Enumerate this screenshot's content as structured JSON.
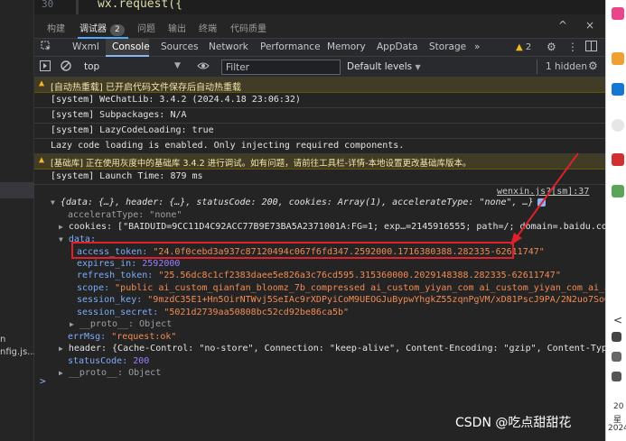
{
  "editor": {
    "line_number": "30",
    "code": "wx.request({",
    "left_fragments": [
      "n",
      "nfig.js..."
    ]
  },
  "panel_tabs": {
    "items": [
      "构建",
      "调试器",
      "问题",
      "输出",
      "终端",
      "代码质量"
    ],
    "debugger_badge": "2",
    "controls": [
      "^",
      "×"
    ]
  },
  "devtools_tabs": {
    "items": [
      "Wxml",
      "Console",
      "Sources",
      "Network",
      "Performance",
      "Memory",
      "AppData",
      "Storage"
    ],
    "more": "»",
    "warning_count": "2"
  },
  "console_toolbar": {
    "context": "top",
    "filter_placeholder": "Filter",
    "levels": "Default levels",
    "hidden": "1 hidden"
  },
  "messages": [
    {
      "type": "warn",
      "text": "[自动热重载] 已开启代码文件保存后自动热重载"
    },
    {
      "type": "log",
      "text": "[system] WeChatLib: 3.4.2 (2024.4.18 23:06:32)"
    },
    {
      "type": "log",
      "text": "[system] Subpackages: N/A"
    },
    {
      "type": "log",
      "text": "[system] LazyCodeLoading: true"
    },
    {
      "type": "log",
      "text": "Lazy code loading is enabled. Only injecting required components."
    },
    {
      "type": "warn",
      "text": "[基础库] 正在使用灰度中的基础库 3.4.2 进行调试。如有问题，请前往工具栏-详情-本地设置更改基础库版本。"
    },
    {
      "type": "log",
      "text": "[system] Launch Time: 879 ms"
    }
  ],
  "log_source": "wenxin.js?[sm]:37",
  "object": {
    "summary": "{data: {…}, header: {…}, statusCode: 200, cookies: Array(1), accelerateType: \"none\", …}",
    "acceleratetype_line": "acceleratType: \"none\"",
    "cookies_line": "cookies: [\"BAIDUID=9CC11D4C92ACC77B9E73BA5A2371001A:FG=1; exp…=2145916555; path=/; domain=.baidu.com; ver…",
    "data_label": "data:",
    "access_token_key": "access_token:",
    "access_token_value": "\"24.0f0cebd3a937c87120494c067f6fd347.2592000.1716380388.282335-62611747\"",
    "expires_in_key": "expires_in:",
    "expires_in_value": "2592000",
    "refresh_token_key": "refresh_token:",
    "refresh_token_value": "\"25.56dc8c1cf2383daee5e826a3c76cd595.315360000.2029148388.282335-62611747\"",
    "scope_key": "scope:",
    "scope_value": "\"public ai_custom_qianfan_bloomz_7b_compressed ai_custom_yiyan_com ai_custom_yiyan_com_ai_apaas",
    "session_key_key": "session_key:",
    "session_key_value": "\"9mzdC35E1+Hn5OirNTWvj5SeIAc9rXDPyiCoM9UEOGJuBypwYhgkZ55zqnPgVM/xD81PscJ9PA/2N2uo7SoGun2A9…",
    "session_secret_key": "session_secret:",
    "session_secret_value": "\"5021d2739aa50808bc52cd92be86ca5b\"",
    "data_proto": "__proto__: Object",
    "errmsg_key": "errMsg:",
    "errmsg_value": "\"request:ok\"",
    "header_line": "header: {Cache-Control: \"no-store\", Connection: \"keep-alive\", Content-Encoding: \"gzip\", Content-Type: \"ap…",
    "statuscode_key": "statusCode:",
    "statuscode_value": "200",
    "root_proto": "__proto__: Object"
  },
  "prompt_symbol": ">",
  "right_strip": {
    "texts": [
      "<",
      "20",
      "星",
      "2024"
    ]
  },
  "watermark": "CSDN @吃点甜甜花",
  "colors": {
    "highlight_border": "#e0202a",
    "string": "#f28b54",
    "number": "#9980ff",
    "key": "#7cacf8"
  }
}
